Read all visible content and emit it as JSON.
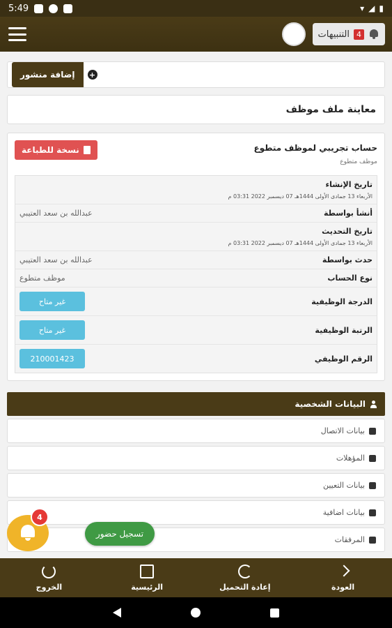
{
  "status_bar": {
    "time": "5:49"
  },
  "header": {
    "notifications_label": "التنبيهات",
    "notifications_count": "4"
  },
  "add_post": {
    "label": "إضافة منشور",
    "icon": "plus-circle-icon"
  },
  "page_title": "معاينة ملف موظف",
  "profile": {
    "account_name": "حساب تجريبي لموظف متطوع",
    "account_type": "موظف متطوع",
    "print_button": "نسخة للطباعة",
    "details": [
      {
        "key": "تاريخ الإنشاء",
        "sub": "الأربعاء 13 جمادى الأولى 1444هـ 07 ديسمبر 2022 03:31 م",
        "kind": "stack"
      },
      {
        "key": "أنشأ بواسطة",
        "value": "عبدالله بن سعد العتيبي",
        "kind": "row"
      },
      {
        "key": "تاريخ التحديث",
        "sub": "الأربعاء 13 جمادى الأولى 1444هـ 07 ديسمبر 2022 03:31 م",
        "kind": "stack"
      },
      {
        "key": "حدث بواسطة",
        "value": "عبدالله بن سعد العتيبي",
        "kind": "row"
      },
      {
        "key": "نوع الحساب",
        "value": "موظف متطوع",
        "kind": "row"
      },
      {
        "key": "الدرجة الوظيفية",
        "value": "غير متاح",
        "kind": "pill"
      },
      {
        "key": "الرتبة الوظيفية",
        "value": "غير متاح",
        "kind": "pill"
      },
      {
        "key": "الرقم الوظيفي",
        "value": "210001423",
        "kind": "pill"
      }
    ]
  },
  "sections": {
    "personal": "البيانات الشخصية",
    "items": [
      {
        "label": "بيانات الاتصال",
        "icon": "phone-icon"
      },
      {
        "label": "المؤهلات",
        "icon": "briefcase-icon"
      },
      {
        "label": "بيانات التعيين",
        "icon": "building-icon"
      },
      {
        "label": "بيانات اضافية",
        "icon": "plus-icon"
      },
      {
        "label": "المرفقات",
        "icon": "paperclip-icon"
      }
    ]
  },
  "floating": {
    "badge": "4",
    "attend": "تسجيل حضور"
  },
  "bottom_nav": [
    {
      "label": "الخروج",
      "icon": "power-icon"
    },
    {
      "label": "الرئيسية",
      "icon": "home-icon"
    },
    {
      "label": "إعادة التحميل",
      "icon": "reload-icon"
    },
    {
      "label": "العودة",
      "icon": "back-icon"
    }
  ],
  "colors": {
    "brand": "#4a3b17",
    "danger": "#e05252",
    "info": "#5bc0de",
    "success": "#3f9a44",
    "accent": "#f0b429"
  }
}
